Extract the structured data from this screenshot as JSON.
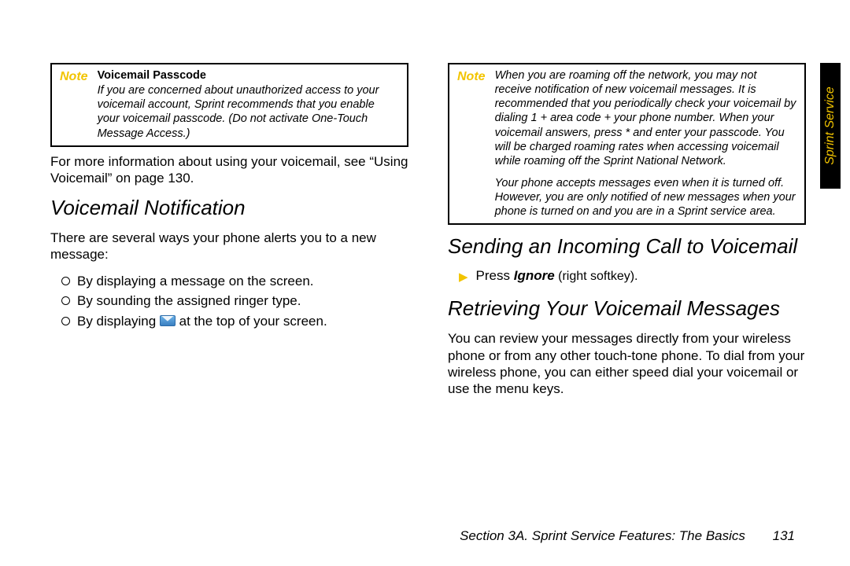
{
  "sideTab": "Sprint Service",
  "left": {
    "note": {
      "label": "Note",
      "title": "Voicemail Passcode",
      "body": "If you are concerned about unauthorized access to your voicemail account, Sprint recommends that you enable your voicemail passcode. (Do not activate One-Touch Message Access.)"
    },
    "moreInfo": "For more information about using your voicemail, see “Using Voicemail” on page 130.",
    "h_notification": "Voicemail Notification",
    "notif_intro": "There are several ways your phone alerts you to a new message:",
    "bullets": {
      "b1": "By displaying a message on the screen.",
      "b2": "By sounding the assigned ringer type.",
      "b3a": "By displaying ",
      "b3b": " at the top of your screen."
    }
  },
  "right": {
    "note": {
      "label": "Note",
      "p1": "When you are roaming off the network, you may not receive notification of new voicemail messages. It is recommended that you periodically check your voicemail by dialing 1 + area code + your phone number. When your voicemail answers, press * and enter your passcode. You will be charged roaming rates when accessing voicemail while roaming off the Sprint National Network.",
      "p2": "Your phone accepts messages even when it is turned off. However, you are only notified of new messages when your phone is turned on and you are in a Sprint service area."
    },
    "h_sending": "Sending an Incoming Call to Voicemail",
    "press_pre": "Press ",
    "press_bold": "Ignore",
    "press_post": " (right softkey).",
    "h_retrieving": "Retrieving Your Voicemail Messages",
    "retrieving_body": "You can review your messages directly from your wireless phone or from any other touch-tone phone. To dial from your wireless phone, you can either speed dial your voicemail or use the menu keys."
  },
  "footer": {
    "section": "Section 3A. Sprint Service Features: The Basics",
    "page": "131"
  }
}
